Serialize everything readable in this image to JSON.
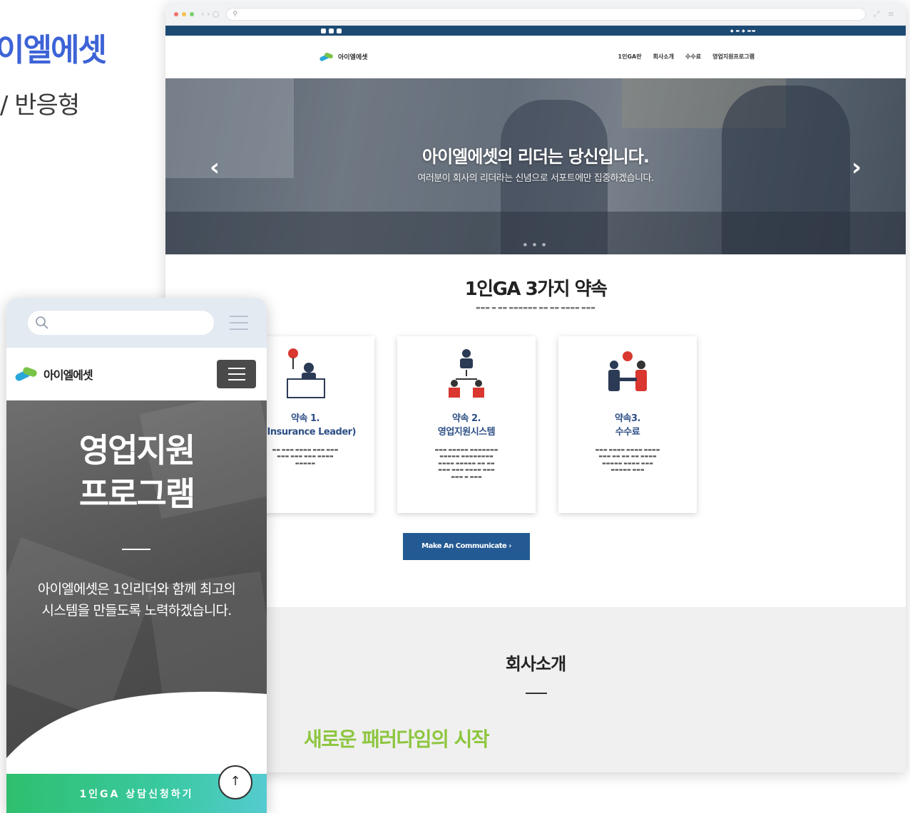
{
  "heading": {
    "title": "이엘에셋",
    "subtitle": "/ 반응형"
  },
  "desktop": {
    "address_icon": "search-icon",
    "brand": "아이엘에셋",
    "menu": [
      "1인GA란",
      "회사소개",
      "수수료",
      "영업지원프로그램"
    ],
    "hero": {
      "title": "아이엘에셋의 리더는 당신입니다.",
      "subtitle": "여러분이 회사의 리더라는 신념으로 서포트에만 집중하겠습니다."
    },
    "promise": {
      "title": "1인GA 3가지 약속",
      "cards": [
        {
          "label": "약속 1.",
          "name": "IL(Insurance Leader)",
          "icon": "speaker-at-podium-icon"
        },
        {
          "label": "약속 2.",
          "name": "영업지원시스템",
          "icon": "team-hierarchy-icon"
        },
        {
          "label": "약속3.",
          "name": "수수료",
          "icon": "handshake-icon"
        }
      ],
      "cta": "Make An Communicate  ›"
    },
    "about": {
      "title": "회사소개",
      "subtitle": "새로운 패러다임의 시작"
    }
  },
  "mobile": {
    "brand": "아이엘에셋",
    "hero_title_line1": "영업지원",
    "hero_title_line2": "프로그램",
    "hero_desc_line1": "아이엘에셋은 1인리더와 함께 최고의",
    "hero_desc_line2": "시스템을 만들도록 노력하겠습니다.",
    "cta": "1인GA 상담신청하기",
    "scroll_top": "↑"
  },
  "colors": {
    "accent_blue": "#3d63d6",
    "navy": "#235a93",
    "topbar": "#1c4a73",
    "green": "#8dc63f",
    "cta_green": "#2fbf6e"
  }
}
